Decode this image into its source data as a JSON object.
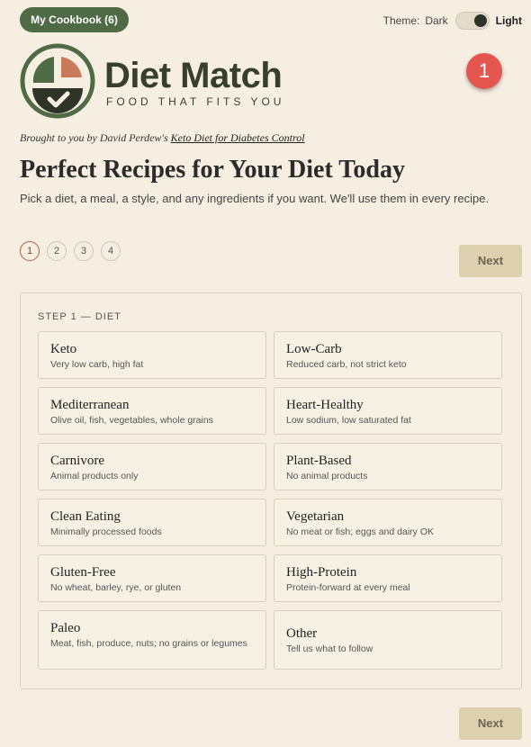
{
  "header": {
    "cookbook_label": "My Cookbook (6)",
    "theme_label": "Theme:",
    "theme_dark": "Dark",
    "theme_light": "Light",
    "theme_selected": "Light"
  },
  "logo": {
    "wordmark": "Diet Match",
    "tagline": "FOOD THAT FITS YOU"
  },
  "notification_count": "1",
  "attribution": {
    "prefix": "Brought to you by David Perdew's ",
    "link_text": "Keto Diet for Diabetes Control"
  },
  "headline": "Perfect Recipes for Your Diet Today",
  "subheadline": "Pick a diet, a meal, a style, and any ingredients if you want. We'll use them in every recipe.",
  "steps": [
    "1",
    "2",
    "3",
    "4"
  ],
  "active_step": 1,
  "next_label": "Next",
  "panel": {
    "step_label": "STEP 1 — DIET",
    "options": [
      {
        "title": "Keto",
        "desc": "Very low carb, high fat"
      },
      {
        "title": "Low-Carb",
        "desc": "Reduced carb, not strict keto"
      },
      {
        "title": "Mediterranean",
        "desc": "Olive oil, fish, vegetables, whole grains"
      },
      {
        "title": "Heart-Healthy",
        "desc": "Low sodium, low saturated fat"
      },
      {
        "title": "Carnivore",
        "desc": "Animal products only"
      },
      {
        "title": "Plant-Based",
        "desc": "No animal products"
      },
      {
        "title": "Clean Eating",
        "desc": "Minimally processed foods"
      },
      {
        "title": "Vegetarian",
        "desc": "No meat or fish; eggs and dairy OK"
      },
      {
        "title": "Gluten-Free",
        "desc": "No wheat, barley, rye, or gluten"
      },
      {
        "title": "High-Protein",
        "desc": "Protein-forward at every meal"
      },
      {
        "title": "Paleo",
        "desc": "Meat, fish, produce, nuts; no grains or legumes"
      },
      {
        "title": "Other",
        "desc": "Tell us what to follow"
      }
    ]
  },
  "colors": {
    "background": "#f6efe1",
    "brand_green": "#4f6b45",
    "logo_text": "#37402d",
    "logo_accent": "#c97a5a",
    "badge_red": "#e5574e",
    "next_button": "#ddd0ae",
    "active_step": "#b35d3c"
  }
}
